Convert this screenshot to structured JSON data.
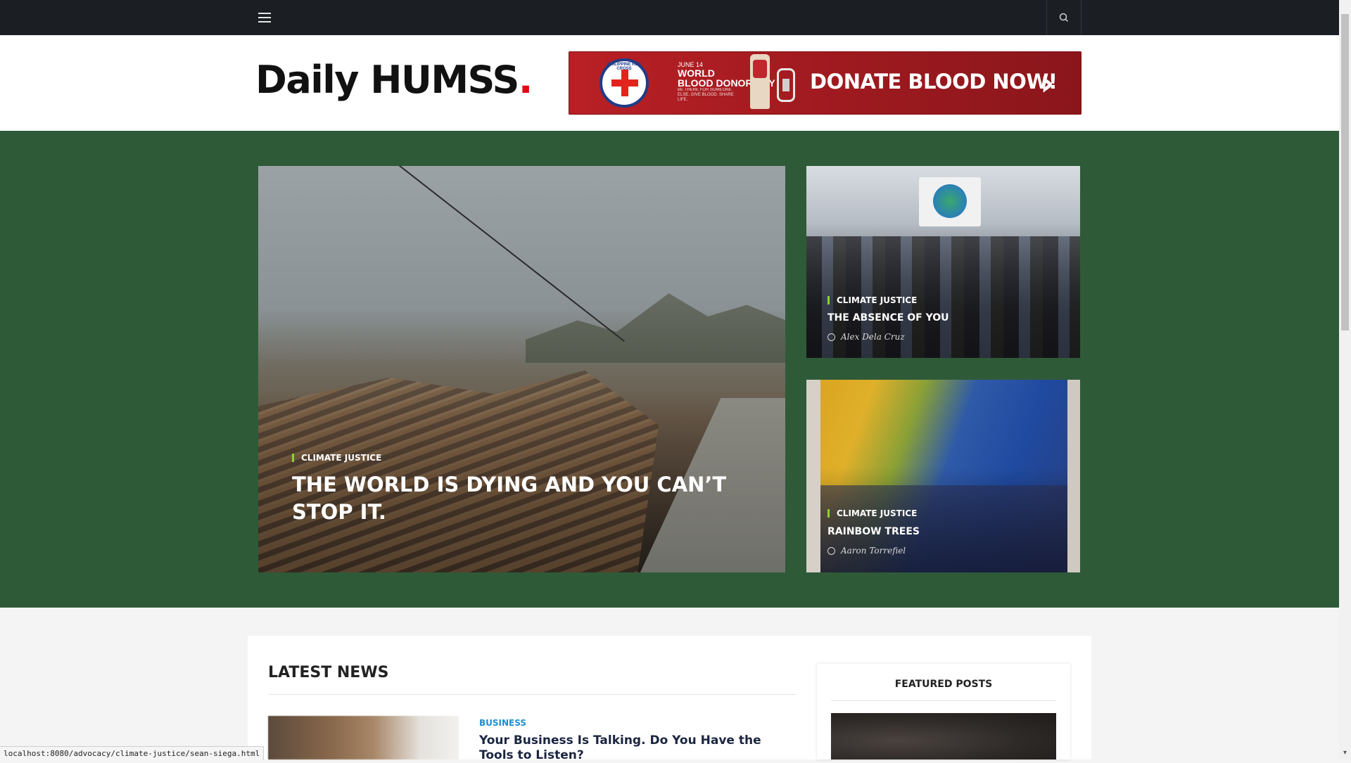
{
  "topbar": {
    "menu_icon": "hamburger-menu-icon",
    "search_icon": "search-icon"
  },
  "header": {
    "logo_text": "Daily HUMSS",
    "logo_dot": ".",
    "banner": {
      "org": "PHILIPPINE RED CROSS",
      "event_date": "JUNE 14",
      "event_name_1": "WORLD",
      "event_name_2": "BLOOD DONOR DAY",
      "event_tagline": "BE THERE FOR SOMEONE ELSE. GIVE BLOOD. SHARE LIFE.",
      "cta": "DONATE BLOOD NOW!",
      "chevron": "›"
    }
  },
  "hero": {
    "main": {
      "category": "CLIMATE JUSTICE",
      "title": "THE WORLD IS DYING AND YOU CAN’T STOP IT."
    },
    "side": [
      {
        "category": "CLIMATE JUSTICE",
        "title": "THE ABSENCE OF YOU",
        "author": "Alex Dela Cruz"
      },
      {
        "category": "CLIMATE JUSTICE",
        "title": "RAINBOW TREES",
        "author": "Aaron Torrefiel"
      }
    ]
  },
  "latest_news": {
    "heading": "LATEST NEWS",
    "items": [
      {
        "category": "BUSINESS",
        "title": "Your Business Is Talking. Do You Have the Tools to Listen?"
      }
    ]
  },
  "sidebar": {
    "featured_heading": "FEATURED POSTS"
  },
  "status_bar": {
    "url": "localhost:8080/advocacy/climate-justice/sean-siega.html"
  },
  "colors": {
    "topbar": "#1b1e23",
    "hero_bg": "#2f5a38",
    "accent_dot": "#e10b12",
    "category_bar": "#8bd32c",
    "news_category": "#1e8fd1"
  }
}
